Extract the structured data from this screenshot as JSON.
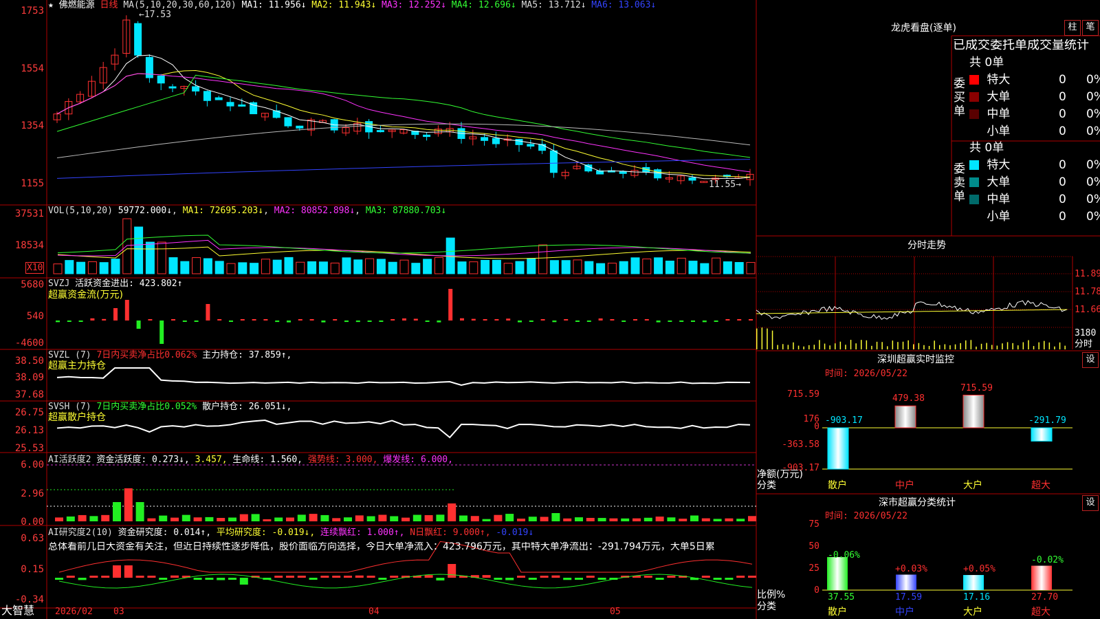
{
  "colors": {
    "up": "#ff3030",
    "down": "#00e5ff",
    "ma1": "#ffffff",
    "ma2": "#ffff33",
    "ma3": "#ff33ff",
    "ma4": "#33ff33",
    "ma5": "#bbbbbb",
    "ma6": "#3344ff",
    "grid": "#b00000",
    "text": "#dddddd"
  },
  "header": {
    "star": "★",
    "stock_name": "佛燃能源",
    "period": "日线",
    "ma_label": "MA(5,10,20,30,60,120)",
    "ma1": "MA1: 11.956↓",
    "ma2": "MA2: 11.943↓",
    "ma3": "MA3: 12.252↓",
    "ma4": "MA4: 12.696↓",
    "ma5": "MA5: 13.712↓",
    "ma6": "MA6: 13.063↓"
  },
  "price_axis": [
    "1753",
    "1554",
    "1354",
    "1155"
  ],
  "price_annot": {
    "high": "←17.53",
    "low": "11.55→"
  },
  "vol": {
    "title": "VOL(5,10,20)",
    "value": "59772.000↓",
    "ma1": "MA1: 72695.203↓",
    "ma2": "MA2: 80852.898↓",
    "ma3": "MA3: 87880.703↓",
    "axis": [
      "37531",
      "18534"
    ],
    "unit": "X10"
  },
  "svzj": {
    "title": "SVZJ",
    "desc": "活跃资金进出: 423.802↑",
    "sub": "超赢资金流(万元)",
    "axis": [
      "5680",
      "540",
      "-4600"
    ]
  },
  "svzl": {
    "title": "SVZL (7)",
    "pct": "7日内买卖净占比0.062%",
    "hold": "主力持仓: 37.859↑,",
    "sub": "超赢主力持仓",
    "axis": [
      "38.50",
      "38.09",
      "37.68"
    ]
  },
  "svsh": {
    "title": "SVSH (7)",
    "pct": "7日内买卖净占比0.052%",
    "hold": "散户持仓: 26.051↓,",
    "sub": "超赢散户持仓",
    "axis": [
      "26.75",
      "26.13",
      "25.53"
    ]
  },
  "ai_active": {
    "title": "AI活跃度2",
    "a": "资金活跃度: 0.273↓,",
    "b": "3.457,",
    "c": "生命线: 1.560,",
    "d": "强势线: 3.000,",
    "e": "爆发线: 6.000,",
    "axis": [
      "6.00",
      "2.96",
      "0.00"
    ]
  },
  "ai_research": {
    "title": "AI研究度2(10)",
    "a": "资金研究度: 0.014↑,",
    "b": "平均研究度: -0.019↓,",
    "c": "连续飘红: 1.000↑,",
    "d": "N日飘红: 9.000↑,",
    "e": "-0.019↓",
    "axis": [
      "0.63",
      "0.15",
      "-0.34"
    ],
    "summary": "总体看前几日大资金有关注，但近日持续性逐步降低，股价面临方向选择，今日大单净流入：423.796万元，其中特大单净流出：-291.794万元，大单5日累"
  },
  "bottom": {
    "brand": "大智慧",
    "d1": "2026/02",
    "d2": "03",
    "d3": "04",
    "d4": "05"
  },
  "dragon": {
    "title": "龙虎看盘(逐单)",
    "btn1": "柱",
    "btn2": "笔",
    "header": "已成交委托单成交量统计",
    "buy_total": "共 0单",
    "buy_label": "委买单",
    "sell_total": "共 0单",
    "sell_label": "委卖单",
    "buy_rows": [
      {
        "name": "特大",
        "count": "0",
        "pct": "0%",
        "color": "#ff0000"
      },
      {
        "name": "大单",
        "count": "0",
        "pct": "0%",
        "color": "#8b0000"
      },
      {
        "name": "中单",
        "count": "0",
        "pct": "0%",
        "color": "#5a0000"
      },
      {
        "name": "小单",
        "count": "0",
        "pct": "0%",
        "color": ""
      }
    ],
    "sell_rows": [
      {
        "name": "特大",
        "count": "0",
        "pct": "0%",
        "color": "#00e5ff"
      },
      {
        "name": "大单",
        "count": "0",
        "pct": "0%",
        "color": "#008b8b"
      },
      {
        "name": "中单",
        "count": "0",
        "pct": "0%",
        "color": "#006a6a"
      },
      {
        "name": "小单",
        "count": "0",
        "pct": "0%",
        "color": ""
      }
    ]
  },
  "intraday": {
    "title": "分时走势",
    "axis": [
      "11.89",
      "11.78",
      "11.66",
      "3180",
      "分时"
    ]
  },
  "monitor": {
    "title": "深圳超赢实时监控",
    "btn": "设",
    "time": "时间: 2026/05/22",
    "axis": [
      "715.59",
      "176",
      "0",
      "-363.58",
      "-903.17"
    ],
    "ylabel": "净额(万元)",
    "xlabel": "分类",
    "categories": [
      "散户",
      "中户",
      "大户",
      "超大"
    ],
    "values": [
      "-903.17",
      "479.38",
      "715.59",
      "-291.79"
    ]
  },
  "classify": {
    "title": "深市超赢分类统计",
    "btn": "设",
    "time": "时间: 2026/05/22",
    "axis": [
      "75",
      "50",
      "25",
      "0"
    ],
    "ylabel": "比例%",
    "xlabel": "分类",
    "categories": [
      "散户",
      "中户",
      "大户",
      "超大"
    ],
    "changes": [
      "-0.06%",
      "+0.03%",
      "+0.05%",
      "-0.02%"
    ],
    "values": [
      "37.55",
      "17.59",
      "17.16",
      "27.70"
    ]
  }
}
